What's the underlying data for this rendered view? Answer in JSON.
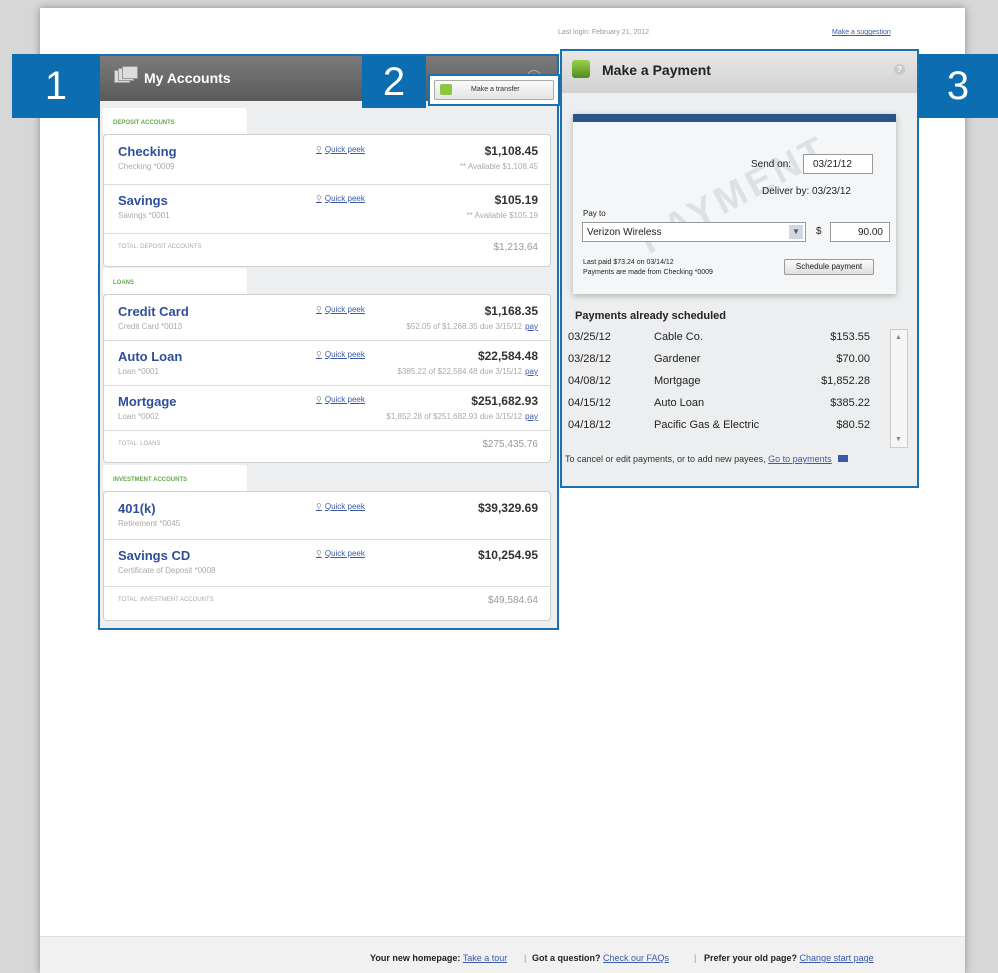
{
  "topbar": {
    "last_login": "Last login: February 21, 2012",
    "suggest": "Make a suggestion"
  },
  "callouts": {
    "one": "1",
    "two": "2",
    "three": "3"
  },
  "accounts": {
    "title": "My Accounts",
    "help": "?",
    "transfer_label": "Make a transfer",
    "peek_label": "Quick peek",
    "sections": {
      "deposit": {
        "tab": "DEPOSIT ACCOUNTS",
        "rows": [
          {
            "name": "Checking",
            "sub": "Checking *0009",
            "value": "$1,108.45",
            "note": "** Available $1,108.45"
          },
          {
            "name": "Savings",
            "sub": "Savings *0001",
            "value": "$105.19",
            "note": "** Available $105.19"
          }
        ],
        "total_label": "TOTAL: DEPOSIT ACCOUNTS",
        "total_value": "$1,213.64"
      },
      "loans": {
        "tab": "LOANS",
        "rows": [
          {
            "name": "Credit Card",
            "sub": "Credit Card *0013",
            "value": "$1,168.35",
            "note": "$52.05 of $1,268.35 due 3/15/12",
            "pay": "pay"
          },
          {
            "name": "Auto Loan",
            "sub": "Loan *0001",
            "value": "$22,584.48",
            "note": "$385.22 of $22,584.48 due 3/15/12",
            "pay": "pay"
          },
          {
            "name": "Mortgage",
            "sub": "Loan *0002",
            "value": "$251,682.93",
            "note": "$1,852.28 of $251,682.93 due 3/15/12",
            "pay": "pay"
          }
        ],
        "total_label": "TOTAL: LOANS",
        "total_value": "$275,435.76"
      },
      "investment": {
        "tab": "INVESTMENT ACCOUNTS",
        "rows": [
          {
            "name": "401(k)",
            "sub": "Retirement *0045",
            "value": "$39,329.69"
          },
          {
            "name": "Savings CD",
            "sub": "Certificate of Deposit *0008",
            "value": "$10,254.95"
          }
        ],
        "total_label": "TOTAL: INVESTMENT ACCOUNTS",
        "total_value": "$49,584.64"
      }
    }
  },
  "payment": {
    "title": "Make a Payment",
    "watermark": "PAYMENT",
    "send_on_label": "Send on:",
    "send_on_value": "03/21/12",
    "deliver_by": "Deliver by: 03/23/12",
    "pay_to_label": "Pay to",
    "payee": "Verizon Wireless",
    "currency": "$",
    "amount": "90.00",
    "last_paid": "Last paid $73.24 on 03/14/12",
    "payments_from": "Payments are made from Checking *0009",
    "schedule_label": "Schedule payment",
    "scheduled_title": "Payments already scheduled",
    "scheduled": [
      {
        "date": "03/25/12",
        "payee": "Cable Co.",
        "amount": "$153.55"
      },
      {
        "date": "03/28/12",
        "payee": "Gardener",
        "amount": "$70.00"
      },
      {
        "date": "04/08/12",
        "payee": "Mortgage",
        "amount": "$1,852.28"
      },
      {
        "date": "04/15/12",
        "payee": "Auto Loan",
        "amount": "$385.22"
      },
      {
        "date": "04/18/12",
        "payee": "Pacific Gas & Electric",
        "amount": "$80.52"
      }
    ],
    "cancel_text": "To cancel or edit payments, or to add new payees,",
    "go_link": "Go to payments"
  },
  "footer": {
    "homepage_label": "Your new homepage:",
    "tour_link": "Take a tour",
    "question_label": "Got a question?",
    "faq_link": "Check our FAQs",
    "old_label": "Prefer your old page?",
    "start_link": "Change start page"
  }
}
